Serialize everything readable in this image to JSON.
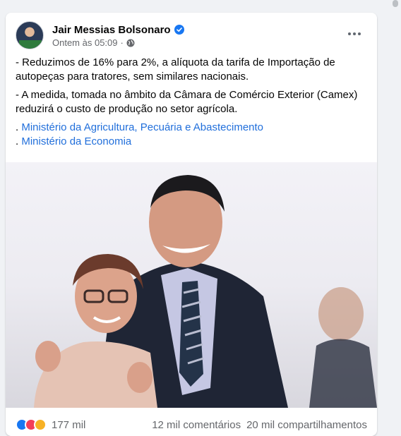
{
  "post": {
    "author": "Jair Messias Bolsonaro",
    "timestamp": "Ontem às 05:09",
    "separator": "·",
    "icons": {
      "verified": "verified-badge-icon",
      "audience": "globe-icon",
      "more": "more-options-icon"
    },
    "paragraphs": [
      "- Reduzimos de 16% para 2%, a alíquota da tarifa de Importação de autopeças para tratores, sem similares nacionais.",
      "- A medida, tomada no âmbito da Câmara de Comércio Exterior (Camex) reduzirá o custo de produção no setor agrícola."
    ],
    "links": [
      {
        "prefix": ". ",
        "label": "Ministério da Agricultura, Pecuária e Abastecimento"
      },
      {
        "prefix": ". ",
        "label": "Ministério da Economia"
      }
    ],
    "reactions": {
      "types": [
        "like-icon",
        "love-icon",
        "care-icon"
      ],
      "count": "177 mil"
    },
    "comments": "12 mil comentários",
    "shares": "20 mil compartilhamentos"
  },
  "colors": {
    "link": "#216fdb",
    "verified": "#1877f2",
    "secondary_text": "#65676b"
  }
}
